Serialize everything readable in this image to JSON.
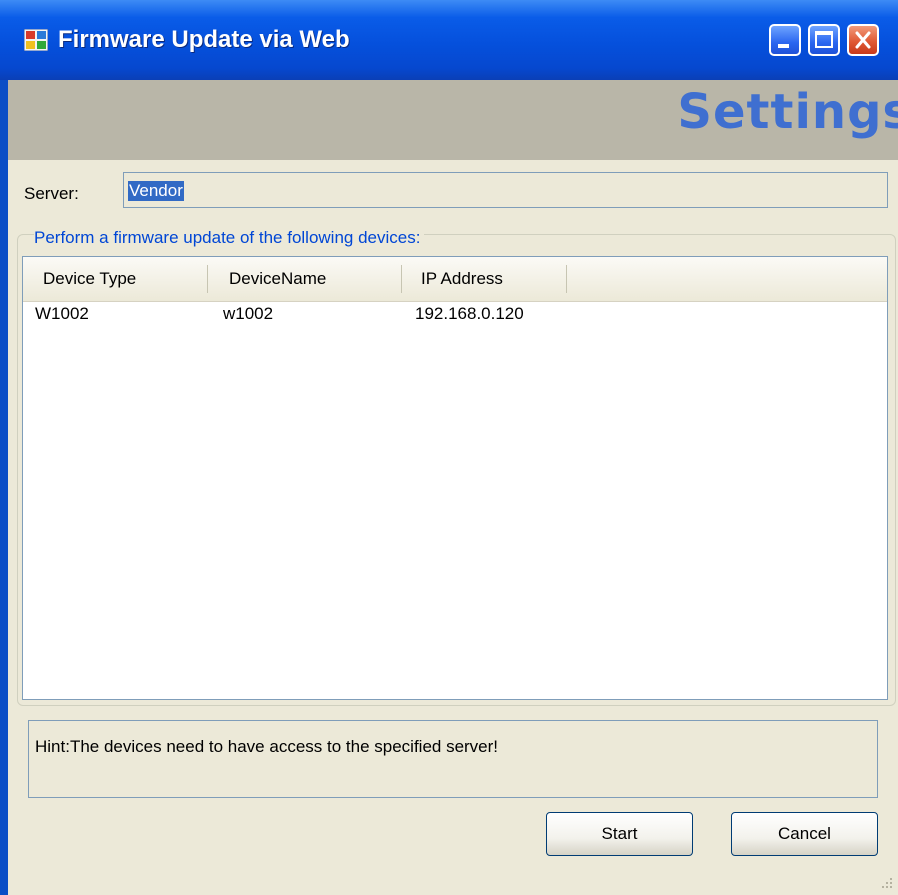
{
  "window": {
    "title": "Firmware Update via Web",
    "header_title": "Settings"
  },
  "server": {
    "label": "Server:",
    "value": "Vendor"
  },
  "devices_group": {
    "caption": "Perform a firmware update of the following devices:",
    "columns": [
      "Device Type",
      "DeviceName",
      "IP Address"
    ],
    "rows": [
      [
        "W1002",
        "w1002",
        "192.168.0.120"
      ]
    ]
  },
  "hint": {
    "text": "Hint:The devices need to have access to the specified server!"
  },
  "buttons": {
    "start": "Start",
    "cancel": "Cancel"
  },
  "icons": {
    "app": "app-window-icon",
    "minimize": "minimize-icon",
    "maximize": "maximize-icon",
    "close": "close-icon",
    "grip": "resize-grip-icon"
  },
  "colors": {
    "titlebar": "#0a5ce8",
    "header_text": "#3f6fd0",
    "group_caption": "#0046d5",
    "selection": "#316ac5"
  }
}
